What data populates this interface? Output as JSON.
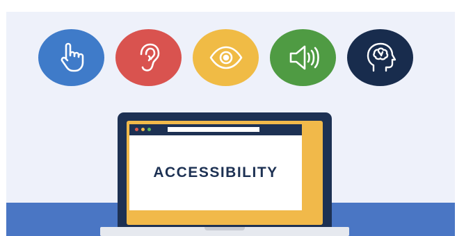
{
  "headline": "ACCESSIBILITY",
  "icons": [
    {
      "name": "touch-hand-icon",
      "circle_color": "#3f7bc9"
    },
    {
      "name": "ear-icon",
      "circle_color": "#d9534f"
    },
    {
      "name": "eye-icon",
      "circle_color": "#f0bb45"
    },
    {
      "name": "speaker-icon",
      "circle_color": "#4f9b43"
    },
    {
      "name": "brain-head-icon",
      "circle_color": "#182c4d"
    }
  ],
  "colors": {
    "background": "#eef1fa",
    "floor": "#4a76c4",
    "laptop_frame": "#1d3153",
    "laptop_bezel": "#f1b94a",
    "browser_dot_red": "#e05a4f",
    "browser_dot_yellow": "#f1b94a",
    "browser_dot_green": "#5cb85c"
  }
}
